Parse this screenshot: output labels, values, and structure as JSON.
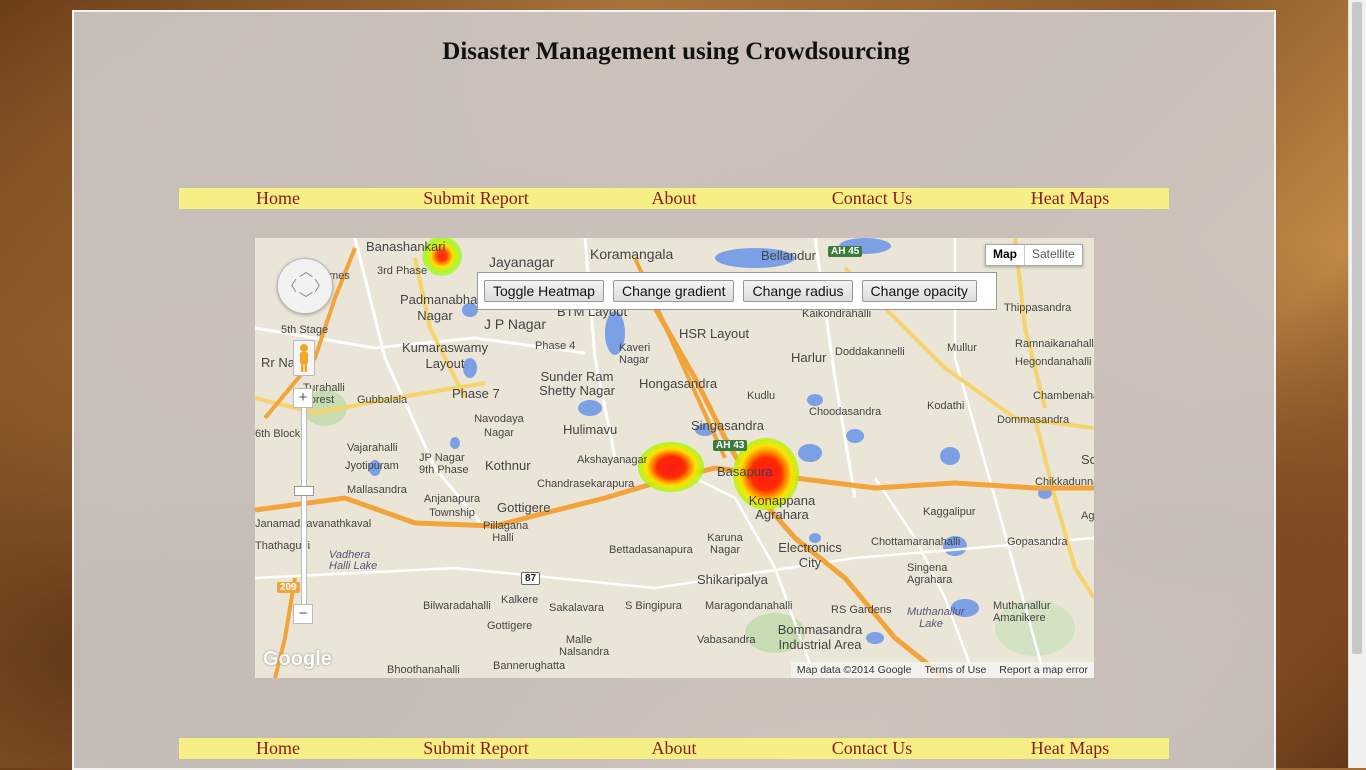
{
  "page": {
    "title": "Disaster Management using Crowdsourcing"
  },
  "nav_top": {
    "items": [
      "Home",
      "Submit Report",
      "About",
      "Contact Us",
      "Heat Maps"
    ]
  },
  "nav_bottom": {
    "items": [
      "Home",
      "Submit Report",
      "About",
      "Contact Us",
      "Heat Maps"
    ]
  },
  "map": {
    "map_type": {
      "map": "Map",
      "satellite": "Satellite",
      "selected": "Map"
    },
    "controls": {
      "toggle_heatmap": "Toggle Heatmap",
      "change_gradient": "Change gradient",
      "change_radius": "Change radius",
      "change_opacity": "Change opacity"
    },
    "zoom": {
      "plus": "+",
      "minus": "−"
    },
    "logo": "Google",
    "attribution": {
      "data": "Map data ©2014 Google",
      "terms": "Terms of Use",
      "report": "Report a map error"
    },
    "shields": [
      "AH 45",
      "AH 43",
      "209",
      "87"
    ],
    "places": [
      "Banashankari",
      "Jayanagar",
      "Koramangala",
      "Bellandur",
      "Idealhomes",
      "3rd Phase",
      "Padmanabha Nagar",
      "J P Nagar",
      "BTM Layout",
      "HSR Layout",
      "Kaikondrahalli",
      "Thippasandra",
      "5th Stage",
      "Rr Nagar",
      "Kumaraswamy Layout",
      "Phase 4",
      "Kaveri Nagar",
      "Harlur",
      "Doddakannelli",
      "Mullur",
      "Ramnaikanahalli",
      "Hegondanahalli",
      "Turahalli Forest",
      "Gubbalala",
      "Phase 7",
      "Sunder Ram Shetty Nagar",
      "Hongasandra",
      "Kudlu",
      "Choodasandra",
      "Kodathi",
      "Chambenahalli",
      "Dommasandra",
      "6th Block",
      "Navodaya Nagar",
      "Hulimavu",
      "Singasandra",
      "Vajarahalli",
      "Jyotipuram",
      "JP Nagar 9th Phase",
      "Kothnur",
      "Akshayanagar",
      "Basapura",
      "Sompura",
      "Chikkadunnasandra",
      "Mallasandra",
      "Chandrasekarapura",
      "Konappana Agrahara",
      "Anjanapura Township",
      "Gottigere",
      "Karuna Nagar",
      "Electronics City",
      "Kaggalipur",
      "Gopasandra",
      "Agrahara",
      "Thathaguni",
      "Pillagana Halli",
      "Bettadasanapura",
      "Chottamaranahalli",
      "Singena Agrahara",
      "Vadhera Halli Lake",
      "Shikaripalya",
      "Bilwaradahalli",
      "Kalkere",
      "Sakalavara",
      "S Bingipura",
      "Maragondanahalli",
      "RS Gardens",
      "Muthanallur Lake",
      "Muthanallur Amanikere",
      "Gottigere",
      "Malle Nalsandra",
      "Vabasandra",
      "Bommasandra Industrial Area",
      "Bhoothanahalli",
      "Bannerughatta",
      "Janamadhavanathkaval"
    ],
    "heat_colors": [
      "#ff0000",
      "#ffff00",
      "#66ff00"
    ]
  },
  "colors": {
    "nav_bg": "#f6ef86",
    "nav_link": "#8b1a1a",
    "page_bg": "#d2cdcd"
  }
}
